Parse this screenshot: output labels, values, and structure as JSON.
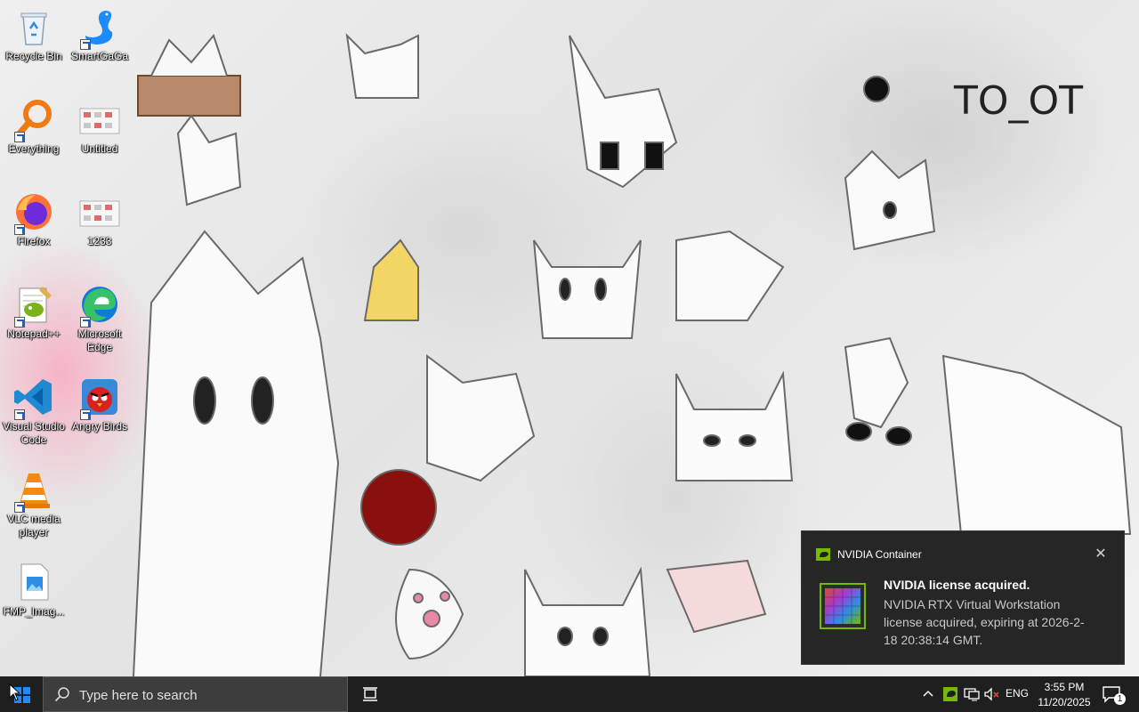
{
  "desktop": {
    "icons": [
      {
        "label": "Recycle Bin"
      },
      {
        "label": "SmartGaGa"
      },
      {
        "label": "Everything"
      },
      {
        "label": "Untitled"
      },
      {
        "label": "Firefox"
      },
      {
        "label": "1233"
      },
      {
        "label": "Notepad++"
      },
      {
        "label": "Microsoft Edge"
      },
      {
        "label": "Visual Studio Code"
      },
      {
        "label": "Angry Birds"
      },
      {
        "label": "VLC media player"
      },
      {
        "label": "FMP_Imag..."
      }
    ],
    "wallpaper_text": "TO_OT"
  },
  "taskbar": {
    "search_placeholder": "Type here to search",
    "language": "ENG",
    "time": "3:55 PM",
    "date": "11/20/2025",
    "notification_count": "1"
  },
  "toast": {
    "app_name": "NVIDIA Container",
    "close_glyph": "✕",
    "title": "NVIDIA license acquired.",
    "body": "NVIDIA RTX Virtual Workstation license acquired, expiring at 2026-2-18 20:38:14 GMT."
  },
  "colors": {
    "taskbar": "#1f1f1f",
    "search_box": "#3d3d3d",
    "toast_bg": "#262626",
    "nvidia_green": "#76b900",
    "windows_blue": "#1a8cff"
  }
}
